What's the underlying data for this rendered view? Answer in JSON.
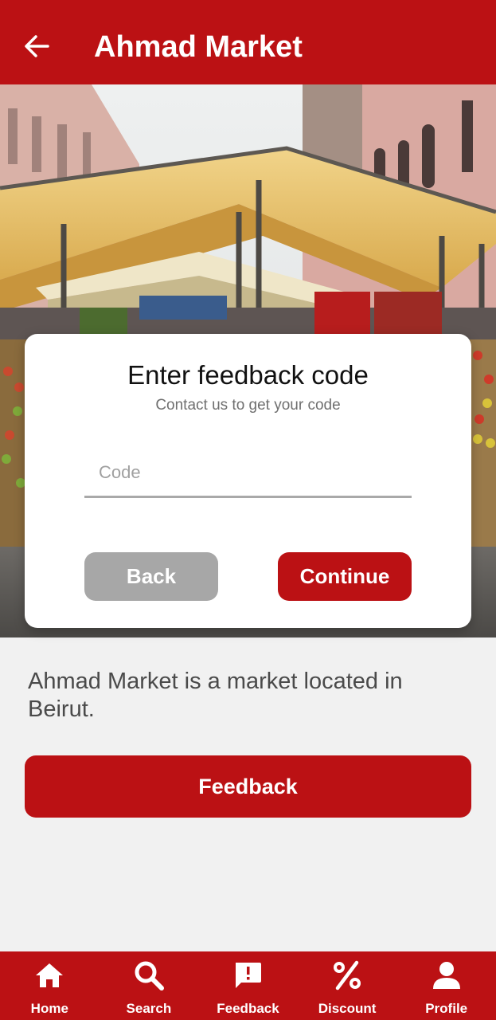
{
  "header": {
    "title": "Ahmad Market",
    "back_icon": "arrow-left-icon"
  },
  "hero": {
    "image": "market-stalls-photo"
  },
  "dialog": {
    "title": "Enter feedback code",
    "subtitle": "Contact us to get your code",
    "code_placeholder": "Code",
    "code_value": "",
    "back_label": "Back",
    "continue_label": "Continue"
  },
  "description": "Ahmad Market is a market located in Beirut.",
  "feedback_button": "Feedback",
  "nav": {
    "items": [
      {
        "label": "Home",
        "icon": "home-icon"
      },
      {
        "label": "Search",
        "icon": "search-icon"
      },
      {
        "label": "Feedback",
        "icon": "feedback-icon"
      },
      {
        "label": "Discount",
        "icon": "percent-icon"
      },
      {
        "label": "Profile",
        "icon": "person-icon"
      }
    ]
  },
  "colors": {
    "primary": "#bb1114",
    "background": "#f1f1f1",
    "secondary_button": "#a7a7a7"
  }
}
